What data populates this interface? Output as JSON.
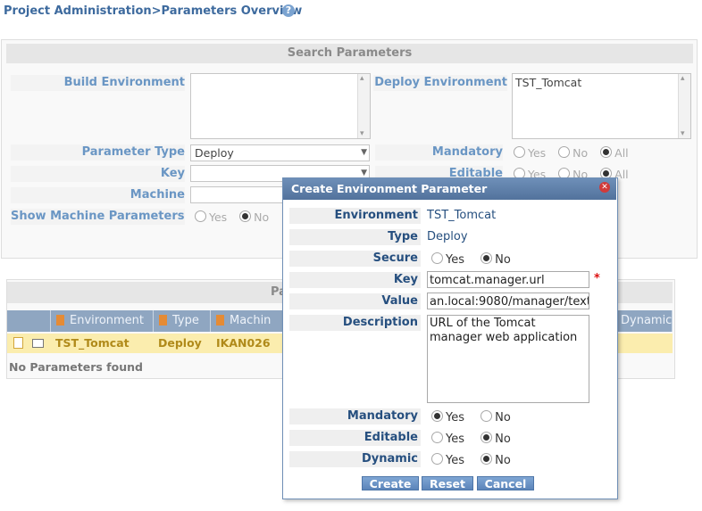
{
  "breadcrumb": "Project Administration>Parameters Overview",
  "search": {
    "header": "Search Parameters",
    "build_env_label": "Build Environment",
    "deploy_env_label": "Deploy Environment",
    "deploy_env_value": "TST_Tomcat",
    "param_type_label": "Parameter Type",
    "param_type_value": "Deploy",
    "key_label": "Key",
    "machine_label": "Machine",
    "show_machine_label": "Show Machine Parameters",
    "mandatory_label": "Mandatory",
    "editable_label": "Editable",
    "opt_yes": "Yes",
    "opt_no": "No",
    "opt_all": "All"
  },
  "results": {
    "header": "Pa",
    "columns": [
      "Environment",
      "Type",
      "Machin",
      "Dynamic"
    ],
    "row": {
      "environment": "TST_Tomcat",
      "type": "Deploy",
      "machine": "IKAN026"
    },
    "empty": "No Parameters found"
  },
  "dialog": {
    "title": "Create Environment Parameter",
    "environment_label": "Environment",
    "environment_value": "TST_Tomcat",
    "type_label": "Type",
    "type_value": "Deploy",
    "secure_label": "Secure",
    "key_label": "Key",
    "key_value": "tomcat.manager.url",
    "value_label": "Value",
    "value_value": "an.local:9080/manager/text",
    "description_label": "Description",
    "description_value": "URL of the Tomcat manager web application",
    "mandatory_label": "Mandatory",
    "editable_label": "Editable",
    "dynamic_label": "Dynamic",
    "yes": "Yes",
    "no": "No",
    "required_marker": "*",
    "create_button": "Create",
    "reset_button": "Reset",
    "cancel_button": "Cancel"
  },
  "colors": {
    "accent": "#5b84b9",
    "header": "#8fa6c1",
    "row_highlight": "#fbedae",
    "required": "#dd1111"
  }
}
